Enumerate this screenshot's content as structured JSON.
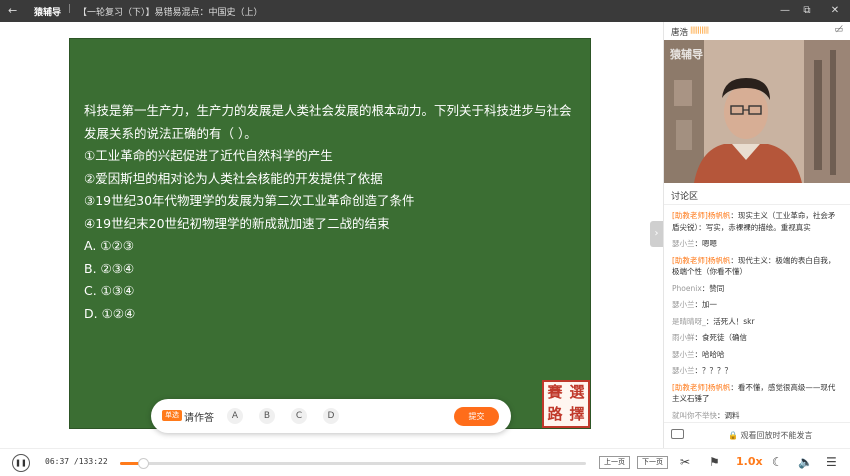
{
  "titlebar": {
    "back_icon": "back-arrow-icon",
    "app_name": "猿辅导",
    "separator": "|",
    "lesson_title": "【一轮复习（下）】易错易混点：中国史（上）",
    "minimize": "—",
    "restore": "⧉",
    "close": "✕"
  },
  "question": {
    "lines": [
      "科技是第一生产力，生产力的发展是人类社会发展的根本动力。下列关于科技进步与社会",
      "发展关系的说法正确的有（  ）。",
      "①工业革命的兴起促进了近代自然科学的产生",
      "②爱因斯坦的相对论为人类社会核能的开发提供了依据",
      "③19世纪30年代物理学的发展为第二次工业革命创造了条件",
      "④19世纪末20世纪初物理学的新成就加速了二战的结束",
      "A.   ①②③",
      "B.   ②③④",
      "C.   ①③④",
      "D.   ①②④"
    ],
    "stamp_chars": [
      "賽",
      "選",
      "路",
      "擇"
    ]
  },
  "answer_bar": {
    "tag": "单选",
    "prompt": "请作答",
    "options": [
      "A",
      "B",
      "C",
      "D"
    ],
    "submit": "提交"
  },
  "teacher": {
    "name": "唐浩",
    "signal": "||||||||||",
    "camera_icon": "camera-off-icon",
    "watermark": "猿辅导"
  },
  "discussion": {
    "header": "讨论区",
    "collapse_icon": "chevron-right-icon",
    "messages": [
      {
        "user": "[助教老师]杨帆帆",
        "teacher": true,
        "text": "：现实主义（工业革命，社会矛盾尖锐）：写实，赤裸裸的描绘。重视真实"
      },
      {
        "user": "瑟小兰",
        "teacher": false,
        "text": "：嗯嗯"
      },
      {
        "user": "[助教老师]杨帆帆",
        "teacher": true,
        "text": "：现代主义：极端的表白自我，极端个性（你看不懂）"
      },
      {
        "user": "Phoenix",
        "teacher": false,
        "text": "：赞同"
      },
      {
        "user": "瑟小兰",
        "teacher": false,
        "text": "：加一"
      },
      {
        "user": "是晴晴呀_",
        "teacher": false,
        "text": "：活死人！skr"
      },
      {
        "user": "雨小鲜",
        "teacher": false,
        "text": "：食死徒（确信"
      },
      {
        "user": "瑟小兰",
        "teacher": false,
        "text": "：哈哈哈"
      },
      {
        "user": "瑟小兰",
        "teacher": false,
        "text": "：？？？？"
      },
      {
        "user": "[助教老师]杨帆帆",
        "teacher": true,
        "text": "：看不懂，感觉很高级——现代主义石锤了"
      },
      {
        "user": "就叫你不举快",
        "teacher": false,
        "text": "：调料"
      }
    ],
    "footer_icon": "image-icon",
    "footer_note": "🔒 观看回放时不能发言"
  },
  "player": {
    "play_icon": "pause-icon",
    "play_glyph": "❚❚",
    "current": "06:37",
    "total": "/133:22",
    "progress": 0.05,
    "prev_page": "上一页",
    "next_page": "下一页",
    "scissors_icon": "scissors-icon",
    "flag_icon": "flag-icon",
    "speed": "1.0x",
    "night_icon": "moon-icon",
    "volume_icon": "volume-icon",
    "menu_icon": "menu-icon"
  }
}
